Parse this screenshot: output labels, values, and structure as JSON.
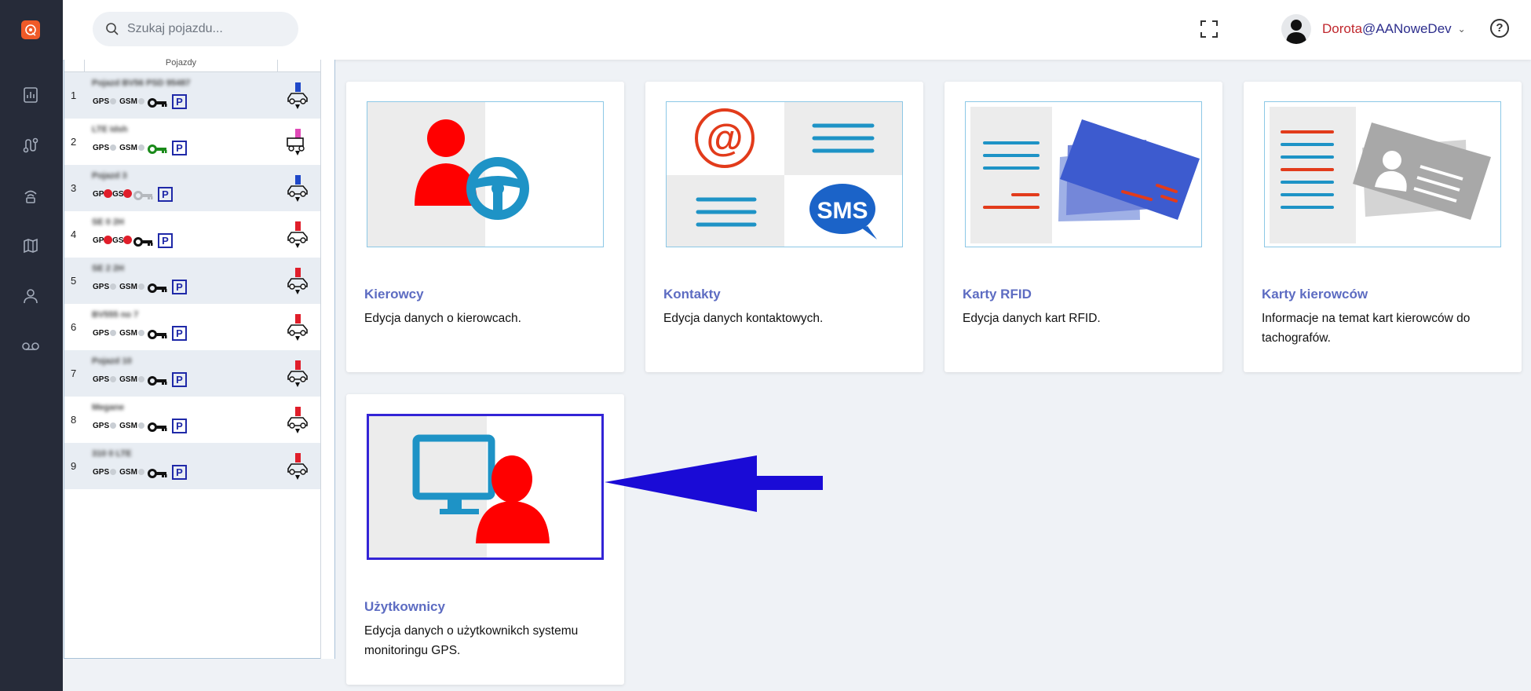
{
  "header": {
    "search_placeholder": "Szukaj pojazdu...",
    "user_name": "Dorota",
    "user_org": "@AANoweDev"
  },
  "vehicle_list": {
    "column_title": "Pojazdy",
    "rows": [
      {
        "num": "1",
        "name": "Pojazd BV56 PSD 95487",
        "key": "black"
      },
      {
        "num": "2",
        "name": "LTE Idsh",
        "key": "green"
      },
      {
        "num": "3",
        "name": "Pojazd 3",
        "key": "grey",
        "alarm": true
      },
      {
        "num": "4",
        "name": "SE 0 2H",
        "key": "black",
        "alarm": true
      },
      {
        "num": "5",
        "name": "SE 2 2H",
        "key": "black"
      },
      {
        "num": "6",
        "name": "BV555 no 7",
        "key": "black"
      },
      {
        "num": "7",
        "name": "Pojazd 10",
        "key": "black"
      },
      {
        "num": "8",
        "name": "Megane",
        "key": "black"
      },
      {
        "num": "9",
        "name": "310 0 LTE",
        "key": "black"
      }
    ],
    "gps_label": "GPS",
    "gsm_label": "GSM",
    "parking_label": "P"
  },
  "cards": [
    {
      "title": "Kierowcy",
      "desc": "Edycja danych o kierowcach."
    },
    {
      "title": "Kontakty",
      "desc": "Edycja danych kontaktowych."
    },
    {
      "title": "Karty RFID",
      "desc": "Edycja danych kart RFID."
    },
    {
      "title": "Karty kierowców",
      "desc": "Informacje na temat kart kierowców do tachografów."
    },
    {
      "title": "Użytkownicy",
      "desc": "Edycja danych o użytkownikch systemu monitoringu GPS."
    }
  ],
  "colors": {
    "accent_title": "#5d6cc2",
    "rail_bg": "#262b39",
    "brand": "#f05a28",
    "arrow": "#1a0bd6"
  },
  "icons": {
    "rail": [
      "reports-icon",
      "routes-icon",
      "signal-icon",
      "map-icon",
      "user-icon",
      "voicemail-icon"
    ]
  }
}
